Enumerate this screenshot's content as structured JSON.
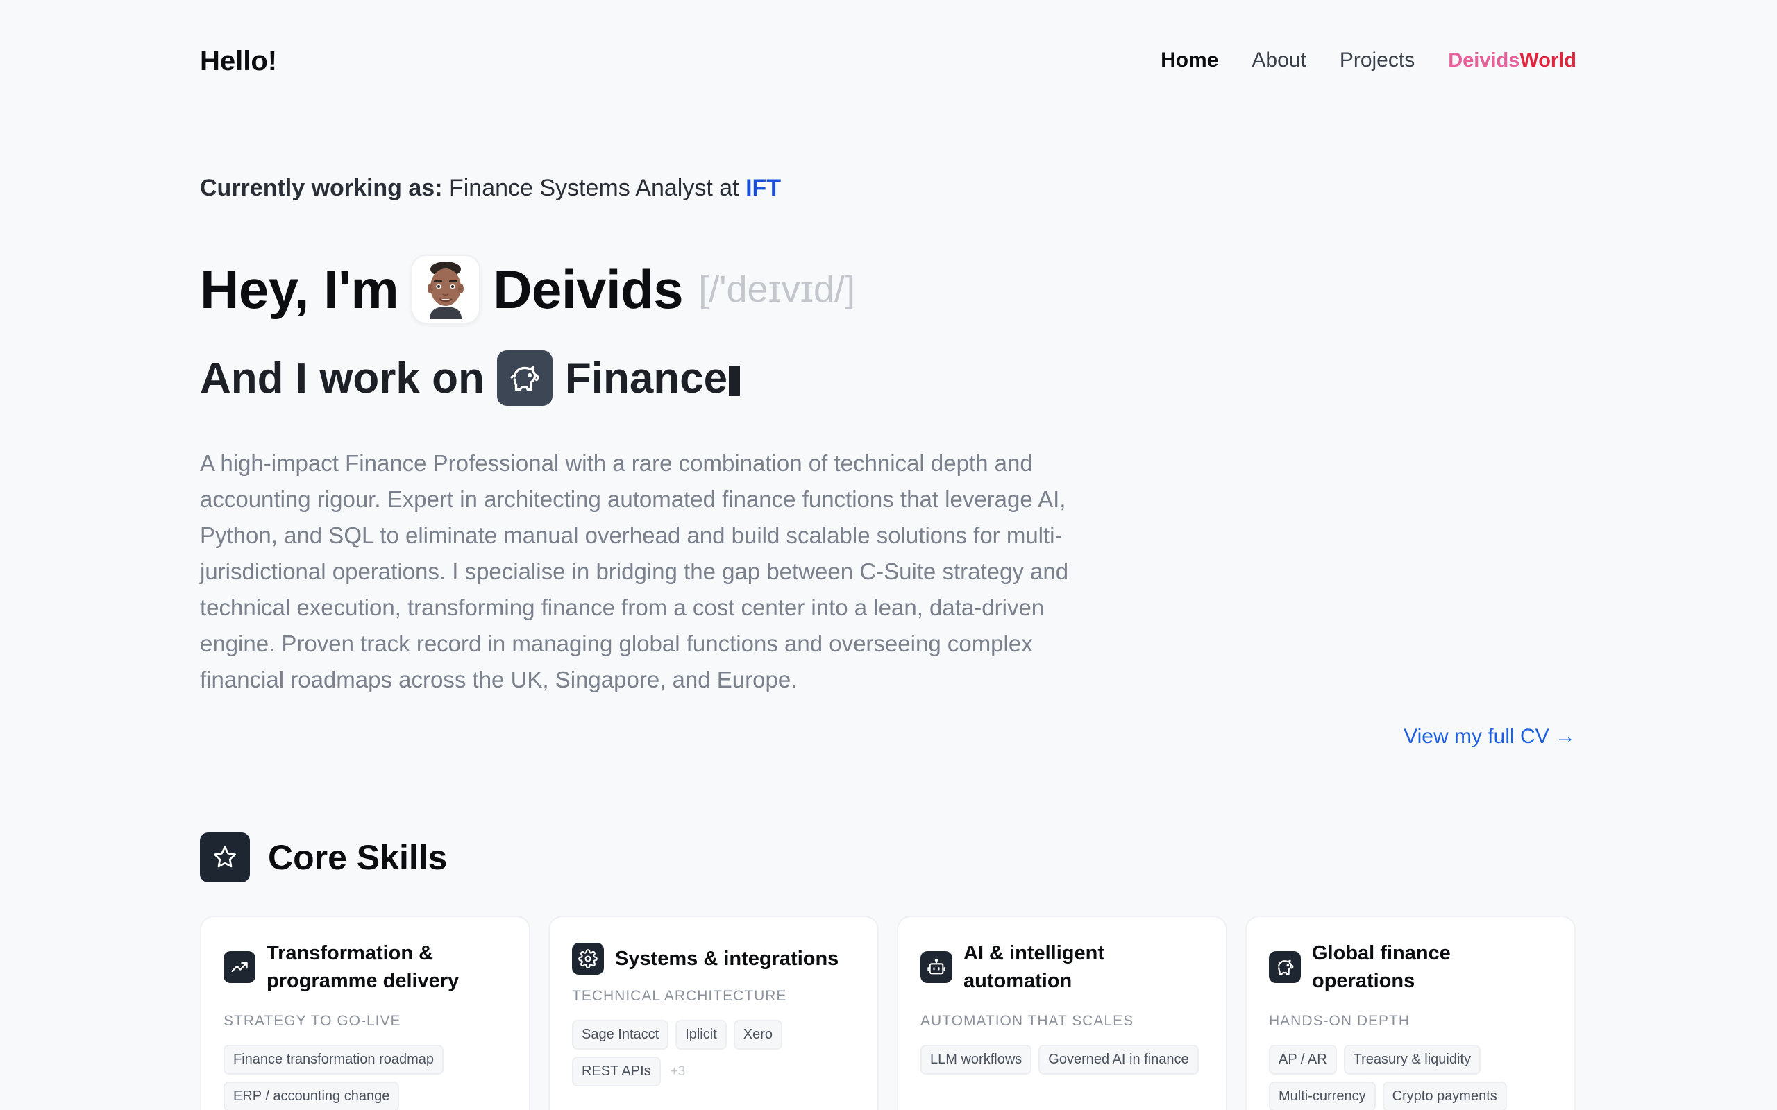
{
  "header": {
    "brand": "Hello!",
    "nav": {
      "home": "Home",
      "about": "About",
      "projects": "Projects",
      "world_part1": "Deivids",
      "world_part2": "World"
    }
  },
  "role": {
    "label": "Currently working as:",
    "title": "Finance Systems Analyst at",
    "company": "IFT"
  },
  "hero": {
    "greeting": "Hey, I'm",
    "name": "Deivids",
    "pronunciation": "[/'deɪvɪd/]",
    "work_prefix": "And I work on",
    "work_field": "Finance"
  },
  "intro": "A high-impact Finance Professional with a rare combination of technical depth and accounting rigour. Expert in architecting automated finance functions that leverage AI, Python, and SQL to eliminate manual overhead and build scalable solutions for multi-jurisdictional operations. I specialise in bridging the gap between C-Suite strategy and technical execution, transforming finance from a cost center into a lean, data-driven engine. Proven track record in managing global functions and overseeing complex financial roadmaps across the UK, Singapore, and Europe.",
  "cv_link": "View my full CV →",
  "skills": {
    "title": "Core Skills",
    "cards": [
      {
        "icon": "trending-up-icon",
        "title": "Transformation & programme delivery",
        "subtitle": "STRATEGY TO GO-LIVE",
        "tags": [
          "Finance transformation roadmap",
          "ERP / accounting change"
        ],
        "more": ""
      },
      {
        "icon": "gear-icon",
        "title": "Systems & integrations",
        "subtitle": "TECHNICAL ARCHITECTURE",
        "tags": [
          "Sage Intacct",
          "Iplicit",
          "Xero",
          "REST APIs"
        ],
        "more": "+3"
      },
      {
        "icon": "robot-icon",
        "title": "AI & intelligent automation",
        "subtitle": "AUTOMATION THAT SCALES",
        "tags": [
          "LLM workflows",
          "Governed AI in finance"
        ],
        "more": ""
      },
      {
        "icon": "piggy-bank-icon",
        "title": "Global finance operations",
        "subtitle": "HANDS-ON DEPTH",
        "tags": [
          "AP / AR",
          "Treasury & liquidity",
          "Multi-currency",
          "Crypto payments"
        ],
        "more": ""
      }
    ]
  },
  "colors": {
    "accent": "#1d4ed8",
    "link": "#1d5fe0",
    "brand_pink": "#e8609a",
    "brand_red": "#e0263f",
    "icon_bg": "#1e2632"
  }
}
